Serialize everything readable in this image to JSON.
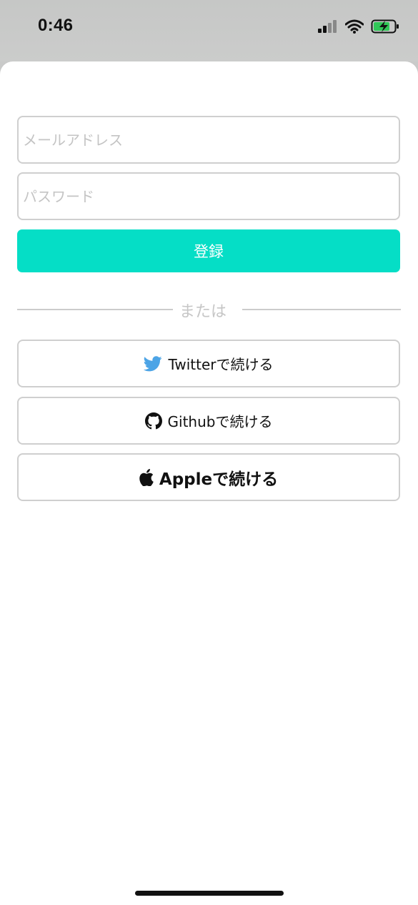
{
  "status_bar": {
    "time": "0:46",
    "icons": [
      "cellular-signal-icon",
      "wifi-icon",
      "battery-charging-icon"
    ]
  },
  "form": {
    "email_placeholder": "メールアドレス",
    "email_value": "",
    "password_placeholder": "パスワード",
    "password_value": "",
    "register_label": "登録"
  },
  "divider": {
    "label": "または"
  },
  "social": {
    "twitter_label": "Twitterで続ける",
    "github_label": "Githubで続ける",
    "apple_label": "Appleで続ける"
  },
  "colors": {
    "accent": "#05DEC6",
    "twitter_blue": "#4CA4E6",
    "border": "#CFCFCF",
    "placeholder": "#C4C4C4"
  }
}
